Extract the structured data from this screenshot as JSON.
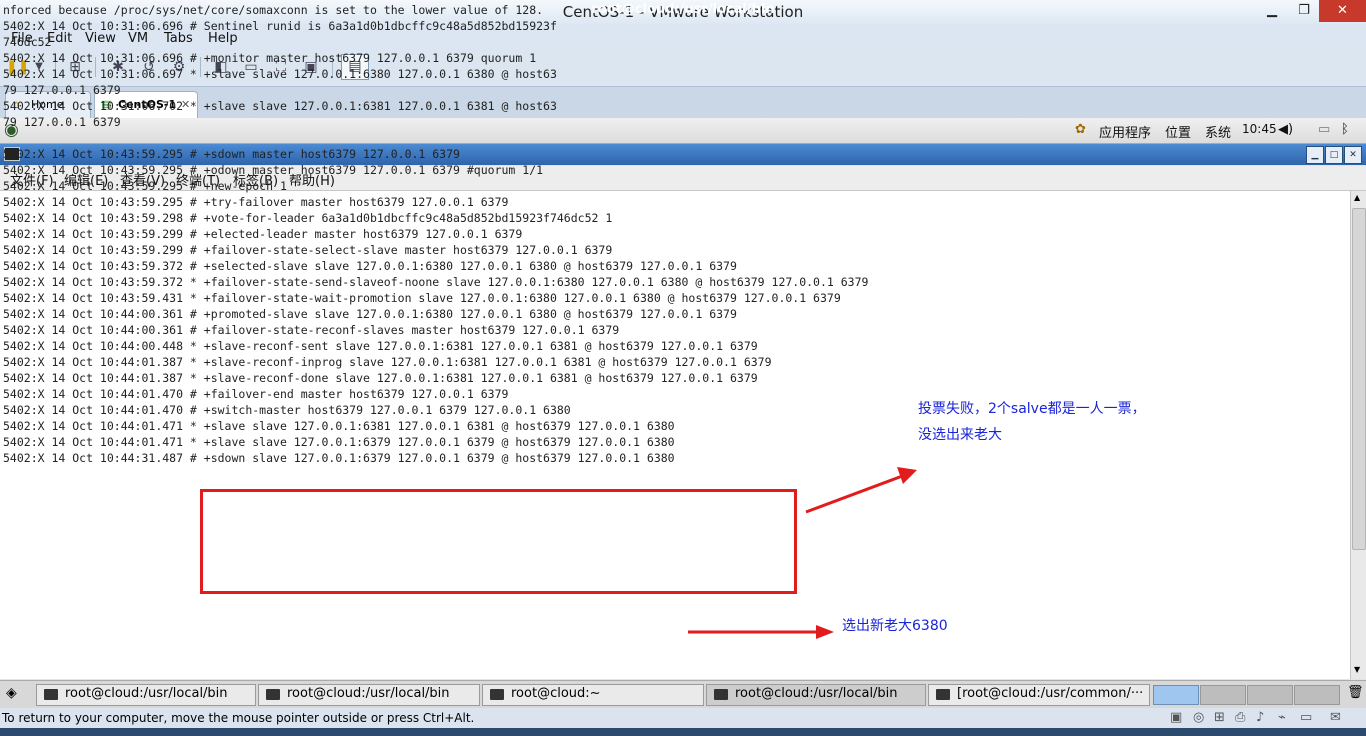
{
  "window": {
    "title": "CentOS-1 - VMware Workstation",
    "min": "▁",
    "max": "❐",
    "close": "✕"
  },
  "menu": [
    "File",
    "Edit",
    "View",
    "VM",
    "Tabs",
    "Help"
  ],
  "tabs": [
    {
      "label": "Home"
    },
    {
      "label": "CentOS-1"
    }
  ],
  "tab_close": "✕",
  "guest_panel": {
    "apps": "应用程序",
    "places": "位置",
    "system": "系统",
    "time": "10:45"
  },
  "terminal": {
    "title": "root@cloud:/usr/local/bin",
    "menu": [
      "文件(F)",
      "编辑(E)",
      "查看(V)",
      "终端(T)",
      "标签(B)",
      "帮助(H)"
    ],
    "lines": [
      "nforced because /proc/sys/net/core/somaxconn is set to the lower value of 128.",
      "5402:X 14 Oct 10:31:06.696 # Sentinel runid is 6a3a1d0b1dbcffc9c48a5d852bd15923f",
      "746dc52",
      "5402:X 14 Oct 10:31:06.696 # +monitor master host6379 127.0.0.1 6379 quorum 1",
      "5402:X 14 Oct 10:31:06.697 * +slave slave 127.0.0.1:6380 127.0.0.1 6380 @ host63",
      "79 127.0.0.1 6379",
      "5402:X 14 Oct 10:31:06.702 * +slave slave 127.0.0.1:6381 127.0.0.1 6381 @ host63",
      "79 127.0.0.1 6379",
      "",
      "5402:X 14 Oct 10:43:59.295 # +sdown master host6379 127.0.0.1 6379",
      "5402:X 14 Oct 10:43:59.295 # +odown master host6379 127.0.0.1 6379 #quorum 1/1",
      "5402:X 14 Oct 10:43:59.295 # +new-epoch 1",
      "5402:X 14 Oct 10:43:59.295 # +try-failover master host6379 127.0.0.1 6379",
      "5402:X 14 Oct 10:43:59.298 # +vote-for-leader 6a3a1d0b1dbcffc9c48a5d852bd15923f746dc52 1",
      "5402:X 14 Oct 10:43:59.299 # +elected-leader master host6379 127.0.0.1 6379",
      "5402:X 14 Oct 10:43:59.299 # +failover-state-select-slave master host6379 127.0.0.1 6379",
      "5402:X 14 Oct 10:43:59.372 # +selected-slave slave 127.0.0.1:6380 127.0.0.1 6380 @ host6379 127.0.0.1 6379",
      "5402:X 14 Oct 10:43:59.372 * +failover-state-send-slaveof-noone slave 127.0.0.1:6380 127.0.0.1 6380 @ host6379 127.0.0.1 6379",
      "5402:X 14 Oct 10:43:59.431 * +failover-state-wait-promotion slave 127.0.0.1:6380 127.0.0.1 6380 @ host6379 127.0.0.1 6379",
      "5402:X 14 Oct 10:44:00.361 # +promoted-slave slave 127.0.0.1:6380 127.0.0.1 6380 @ host6379 127.0.0.1 6379",
      "5402:X 14 Oct 10:44:00.361 # +failover-state-reconf-slaves master host6379 127.0.0.1 6379",
      "5402:X 14 Oct 10:44:00.448 * +slave-reconf-sent slave 127.0.0.1:6381 127.0.0.1 6381 @ host6379 127.0.0.1 6379",
      "5402:X 14 Oct 10:44:01.387 * +slave-reconf-inprog slave 127.0.0.1:6381 127.0.0.1 6381 @ host6379 127.0.0.1 6379",
      "5402:X 14 Oct 10:44:01.387 * +slave-reconf-done slave 127.0.0.1:6381 127.0.0.1 6381 @ host6379 127.0.0.1 6379",
      "5402:X 14 Oct 10:44:01.470 # +failover-end master host6379 127.0.0.1 6379",
      "5402:X 14 Oct 10:44:01.470 # +switch-master host6379 127.0.0.1 6379 127.0.0.1 6380",
      "5402:X 14 Oct 10:44:01.471 * +slave slave 127.0.0.1:6381 127.0.0.1 6381 @ host6379 127.0.0.1 6380",
      "5402:X 14 Oct 10:44:01.471 * +slave slave 127.0.0.1:6379 127.0.0.1 6379 @ host6379 127.0.0.1 6380",
      "5402:X 14 Oct 10:44:31.487 # +sdown slave 127.0.0.1:6379 127.0.0.1 6379 @ host6379 127.0.0.1 6380"
    ]
  },
  "annotations": {
    "vote_line1": "投票失败，2个salve都是一人一票，",
    "vote_line2": "没选出来老大",
    "new_master": "选出新老大6380",
    "color": "#e21c1c"
  },
  "guest_taskbar": [
    {
      "label": "root@cloud:/usr/local/bin"
    },
    {
      "label": "root@cloud:/usr/local/bin"
    },
    {
      "label": "root@cloud:~"
    },
    {
      "label": "root@cloud:/usr/local/bin",
      "active": true
    },
    {
      "label": "[root@cloud:/usr/common/···"
    }
  ],
  "statusbar": {
    "text": "To return to your computer, move the mouse pointer outside or press Ctrl+Alt."
  }
}
